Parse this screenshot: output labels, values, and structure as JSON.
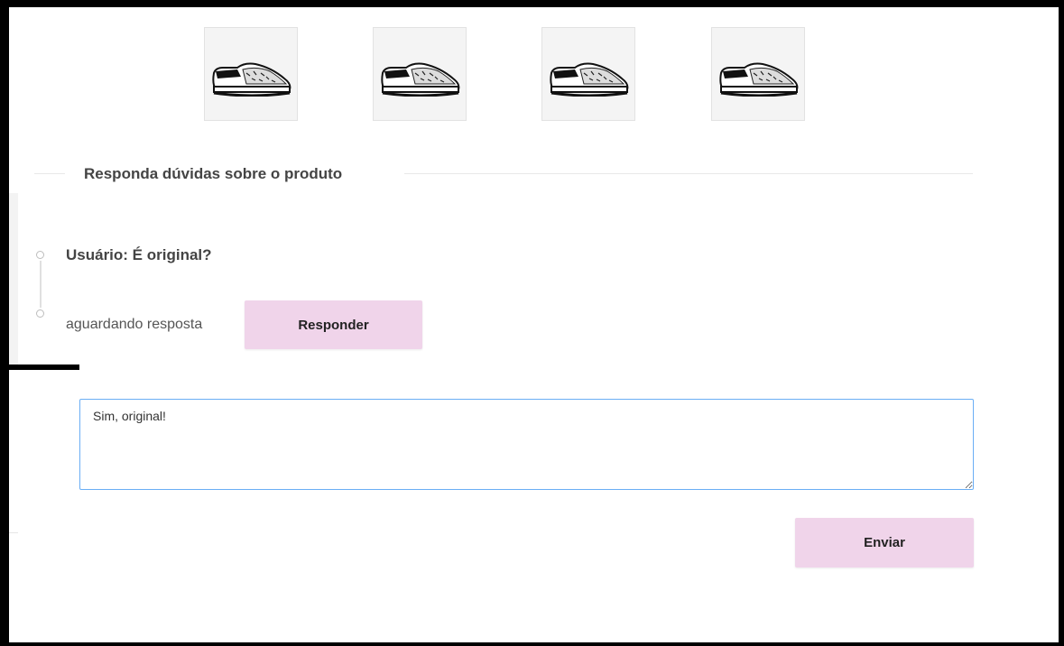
{
  "gallery": {
    "thumbnails": [
      {
        "alt": "shoe-thumbnail-1"
      },
      {
        "alt": "shoe-thumbnail-2"
      },
      {
        "alt": "shoe-thumbnail-3"
      },
      {
        "alt": "shoe-thumbnail-4"
      }
    ]
  },
  "qa": {
    "section_title": "Responda dúvidas sobre o produto",
    "question": "Usuário: É original?",
    "status": "aguardando resposta",
    "respond_label": "Responder",
    "answer_value": "Sim, original!",
    "send_label": "Enviar"
  },
  "colors": {
    "button_bg": "#f0d4ea",
    "textarea_focus_border": "#6aaef5"
  }
}
